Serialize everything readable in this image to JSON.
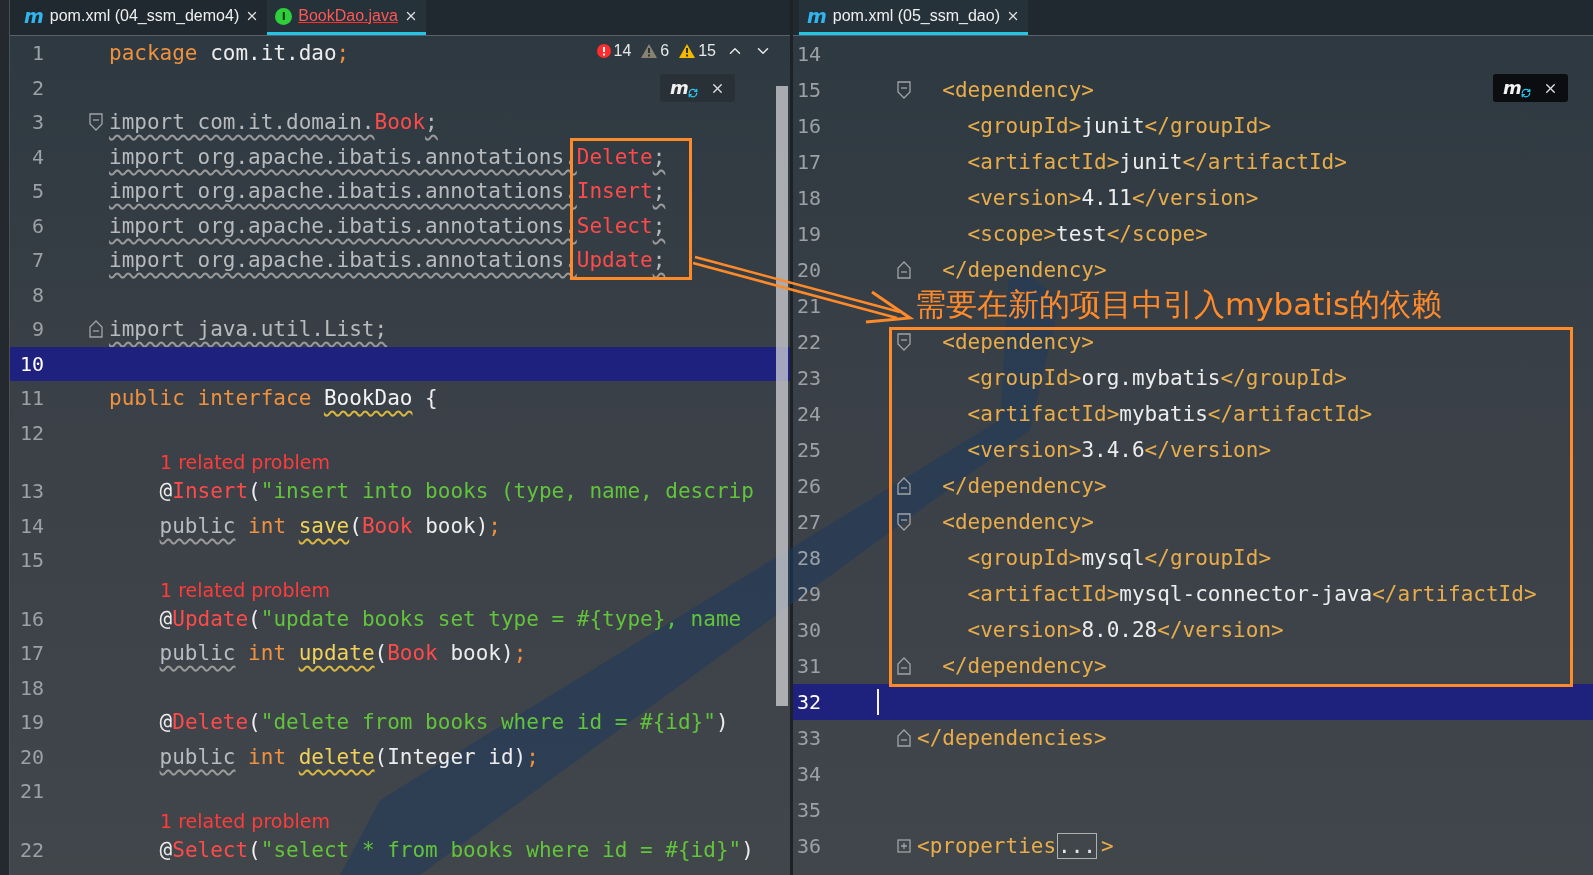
{
  "left_tabs": [
    {
      "kind": "maven",
      "badge": "m",
      "label": "pom.xml (04_ssm_demo4)",
      "selected": false,
      "error": false
    },
    {
      "kind": "interface",
      "badge": "I",
      "label": "BookDao.java",
      "selected": true,
      "error": true
    }
  ],
  "left_editor": {
    "inspections": [
      {
        "kind": "error",
        "count": "14"
      },
      {
        "kind": "weak_warning",
        "count": "6"
      },
      {
        "kind": "warning",
        "count": "15"
      }
    ],
    "maven_widget": {
      "logo": "m"
    },
    "lines": [
      {
        "kind": "code",
        "number": "1",
        "current": false,
        "tokens": [
          {
            "text": "package",
            "kind": "kw"
          },
          {
            "text": " com.it.dao",
            "kind": "plain"
          },
          {
            "text": ";",
            "kind": "kw"
          }
        ]
      },
      {
        "kind": "code",
        "number": "2",
        "current": false
      },
      {
        "kind": "code",
        "number": "3",
        "current": false,
        "fold": {
          "kind": "open"
        },
        "tokens": [
          {
            "text": "import com.it.domain.",
            "kind": "dim"
          },
          {
            "text": "Book",
            "kind": "err"
          },
          {
            "text": ";",
            "kind": "dim"
          }
        ]
      },
      {
        "kind": "code",
        "number": "4",
        "current": false,
        "tokens": [
          {
            "text": "import org.apache.ibatis.annotations.",
            "kind": "dim"
          },
          {
            "text": "Delete",
            "kind": "err"
          },
          {
            "text": ";",
            "kind": "dim"
          }
        ]
      },
      {
        "kind": "code",
        "number": "5",
        "current": false,
        "tokens": [
          {
            "text": "import org.apache.ibatis.annotations.",
            "kind": "dim"
          },
          {
            "text": "Insert",
            "kind": "err"
          },
          {
            "text": ";",
            "kind": "dim"
          }
        ]
      },
      {
        "kind": "code",
        "number": "6",
        "current": false,
        "tokens": [
          {
            "text": "import org.apache.ibatis.annotations.",
            "kind": "dim"
          },
          {
            "text": "Select",
            "kind": "err"
          },
          {
            "text": ";",
            "kind": "dim"
          }
        ]
      },
      {
        "kind": "code",
        "number": "7",
        "current": false,
        "tokens": [
          {
            "text": "import org.apache.ibatis.annotations.",
            "kind": "dim"
          },
          {
            "text": "Update",
            "kind": "err"
          },
          {
            "text": ";",
            "kind": "dim"
          }
        ]
      },
      {
        "kind": "code",
        "number": "8",
        "current": false
      },
      {
        "kind": "code",
        "number": "9",
        "current": false,
        "fold": {
          "kind": "close"
        },
        "tokens": [
          {
            "text": "import java.util.List;",
            "kind": "dim"
          }
        ]
      },
      {
        "kind": "code",
        "number": "10",
        "current": true
      },
      {
        "kind": "code",
        "number": "11",
        "current": false,
        "tokens": [
          {
            "text": "public interface ",
            "kind": "kw"
          },
          {
            "text": "BookDao",
            "kind": "decl"
          },
          {
            "text": " {",
            "kind": "plain"
          }
        ]
      },
      {
        "kind": "code",
        "number": "12",
        "current": false
      },
      {
        "kind": "hint",
        "text": "1 related problem"
      },
      {
        "kind": "code",
        "number": "13",
        "current": false,
        "tokens": [
          {
            "text": "    @",
            "kind": "plain"
          },
          {
            "text": "Insert",
            "kind": "err"
          },
          {
            "text": "(",
            "kind": "plain"
          },
          {
            "text": "\"insert into books (type, name, descrip",
            "kind": "str"
          }
        ]
      },
      {
        "kind": "code",
        "number": "14",
        "current": false,
        "tokens": [
          {
            "text": "    public",
            "kind": "dim"
          },
          {
            "text": " int ",
            "kind": "kw"
          },
          {
            "text": "save",
            "kind": "fn"
          },
          {
            "text": "(",
            "kind": "plain"
          },
          {
            "text": "Book",
            "kind": "err"
          },
          {
            "text": " book)",
            "kind": "plain"
          },
          {
            "text": ";",
            "kind": "kw"
          }
        ]
      },
      {
        "kind": "code",
        "number": "15",
        "current": false
      },
      {
        "kind": "hint",
        "text": "1 related problem"
      },
      {
        "kind": "code",
        "number": "16",
        "current": false,
        "tokens": [
          {
            "text": "    @",
            "kind": "plain"
          },
          {
            "text": "Update",
            "kind": "err"
          },
          {
            "text": "(",
            "kind": "plain"
          },
          {
            "text": "\"update books set type = #{type}, name",
            "kind": "str"
          }
        ]
      },
      {
        "kind": "code",
        "number": "17",
        "current": false,
        "tokens": [
          {
            "text": "    public",
            "kind": "dim"
          },
          {
            "text": " int ",
            "kind": "kw"
          },
          {
            "text": "update",
            "kind": "fn"
          },
          {
            "text": "(",
            "kind": "plain"
          },
          {
            "text": "Book",
            "kind": "err"
          },
          {
            "text": " book)",
            "kind": "plain"
          },
          {
            "text": ";",
            "kind": "kw"
          }
        ]
      },
      {
        "kind": "code",
        "number": "18",
        "current": false
      },
      {
        "kind": "code",
        "number": "19",
        "current": false,
        "tokens": [
          {
            "text": "    @",
            "kind": "plain"
          },
          {
            "text": "Delete",
            "kind": "err"
          },
          {
            "text": "(",
            "kind": "plain"
          },
          {
            "text": "\"delete from books where id = #{id}\"",
            "kind": "str"
          },
          {
            "text": ")",
            "kind": "plain"
          }
        ]
      },
      {
        "kind": "code",
        "number": "20",
        "current": false,
        "tokens": [
          {
            "text": "    public",
            "kind": "dim"
          },
          {
            "text": " int ",
            "kind": "kw"
          },
          {
            "text": "delete",
            "kind": "fn"
          },
          {
            "text": "(Integer id)",
            "kind": "plain"
          },
          {
            "text": ";",
            "kind": "kw"
          }
        ]
      },
      {
        "kind": "code",
        "number": "21",
        "current": false
      },
      {
        "kind": "hint",
        "text": "1 related problem"
      },
      {
        "kind": "code",
        "number": "22",
        "current": false,
        "tokens": [
          {
            "text": "    @",
            "kind": "plain"
          },
          {
            "text": "Select",
            "kind": "err"
          },
          {
            "text": "(",
            "kind": "plain"
          },
          {
            "text": "\"select * from books where id = #{id}\"",
            "kind": "str"
          },
          {
            "text": ")",
            "kind": "plain"
          }
        ]
      }
    ]
  },
  "right_tabs": [
    {
      "kind": "maven",
      "badge": "m",
      "label": "pom.xml (05_ssm_dao)",
      "selected": true,
      "error": false
    }
  ],
  "right_editor": {
    "maven_widget": {
      "logo": "m"
    },
    "lines": [
      {
        "kind": "code",
        "number": "14",
        "current": false
      },
      {
        "kind": "code",
        "number": "15",
        "current": false,
        "fold": {
          "kind": "open"
        },
        "tokens": [
          {
            "text": "  <dependency>",
            "kind": "tag"
          }
        ]
      },
      {
        "kind": "code",
        "number": "16",
        "current": false,
        "tokens": [
          {
            "text": "    <groupId>",
            "kind": "tag"
          },
          {
            "text": "junit",
            "kind": "plain"
          },
          {
            "text": "</groupId>",
            "kind": "tag"
          }
        ]
      },
      {
        "kind": "code",
        "number": "17",
        "current": false,
        "tokens": [
          {
            "text": "    <artifactId>",
            "kind": "tag"
          },
          {
            "text": "junit",
            "kind": "plain"
          },
          {
            "text": "</artifactId>",
            "kind": "tag"
          }
        ]
      },
      {
        "kind": "code",
        "number": "18",
        "current": false,
        "tokens": [
          {
            "text": "    <version>",
            "kind": "tag"
          },
          {
            "text": "4.11",
            "kind": "plain"
          },
          {
            "text": "</version>",
            "kind": "tag"
          }
        ]
      },
      {
        "kind": "code",
        "number": "19",
        "current": false,
        "tokens": [
          {
            "text": "    <scope>",
            "kind": "tag"
          },
          {
            "text": "test",
            "kind": "plain"
          },
          {
            "text": "</scope>",
            "kind": "tag"
          }
        ]
      },
      {
        "kind": "code",
        "number": "20",
        "current": false,
        "fold": {
          "kind": "close"
        },
        "tokens": [
          {
            "text": "  </dependency>",
            "kind": "tag"
          }
        ]
      },
      {
        "kind": "code",
        "number": "21",
        "current": false
      },
      {
        "kind": "code",
        "number": "22",
        "current": false,
        "fold": {
          "kind": "open"
        },
        "tokens": [
          {
            "text": "  <dependency>",
            "kind": "tag"
          }
        ]
      },
      {
        "kind": "code",
        "number": "23",
        "current": false,
        "tokens": [
          {
            "text": "    <groupId>",
            "kind": "tag"
          },
          {
            "text": "org.mybatis",
            "kind": "plain"
          },
          {
            "text": "</groupId>",
            "kind": "tag"
          }
        ]
      },
      {
        "kind": "code",
        "number": "24",
        "current": false,
        "tokens": [
          {
            "text": "    <artifactId>",
            "kind": "tag"
          },
          {
            "text": "mybatis",
            "kind": "plain"
          },
          {
            "text": "</artifactId>",
            "kind": "tag"
          }
        ]
      },
      {
        "kind": "code",
        "number": "25",
        "current": false,
        "tokens": [
          {
            "text": "    <version>",
            "kind": "tag"
          },
          {
            "text": "3.4.6",
            "kind": "plain"
          },
          {
            "text": "</version>",
            "kind": "tag"
          }
        ]
      },
      {
        "kind": "code",
        "number": "26",
        "current": false,
        "fold": {
          "kind": "close"
        },
        "tokens": [
          {
            "text": "  </dependency>",
            "kind": "tag"
          }
        ]
      },
      {
        "kind": "code",
        "number": "27",
        "current": false,
        "fold": {
          "kind": "open"
        },
        "tokens": [
          {
            "text": "  <dependency>",
            "kind": "tag"
          }
        ]
      },
      {
        "kind": "code",
        "number": "28",
        "current": false,
        "tokens": [
          {
            "text": "    <groupId>",
            "kind": "tag"
          },
          {
            "text": "mysql",
            "kind": "plain"
          },
          {
            "text": "</groupId>",
            "kind": "tag"
          }
        ]
      },
      {
        "kind": "code",
        "number": "29",
        "current": false,
        "tokens": [
          {
            "text": "    <artifactId>",
            "kind": "tag"
          },
          {
            "text": "mysql-connector-java",
            "kind": "plain"
          },
          {
            "text": "</artifactId>",
            "kind": "tag"
          }
        ]
      },
      {
        "kind": "code",
        "number": "30",
        "current": false,
        "tokens": [
          {
            "text": "    <version>",
            "kind": "tag"
          },
          {
            "text": "8.0.28",
            "kind": "plain"
          },
          {
            "text": "</version>",
            "kind": "tag"
          }
        ]
      },
      {
        "kind": "code",
        "number": "31",
        "current": false,
        "fold": {
          "kind": "close"
        },
        "tokens": [
          {
            "text": "  </dependency>",
            "kind": "tag"
          }
        ]
      },
      {
        "kind": "code",
        "number": "32",
        "current": true,
        "caret": true
      },
      {
        "kind": "code",
        "number": "33",
        "current": false,
        "fold": {
          "kind": "close"
        },
        "tokens": [
          {
            "text": "</dependencies>",
            "kind": "tag"
          }
        ]
      },
      {
        "kind": "code",
        "number": "34",
        "current": false
      },
      {
        "kind": "code",
        "number": "35",
        "current": false
      },
      {
        "kind": "code",
        "number": "36",
        "current": false,
        "fold": {
          "kind": "expand"
        },
        "tokens": [
          {
            "text": "<properties",
            "kind": "tag"
          },
          {
            "text": "...",
            "kind": "folded"
          },
          {
            "text": ">",
            "kind": "tag"
          }
        ]
      }
    ]
  },
  "annotation": {
    "label": "需要在新的项目中引入mybatis的依赖"
  }
}
